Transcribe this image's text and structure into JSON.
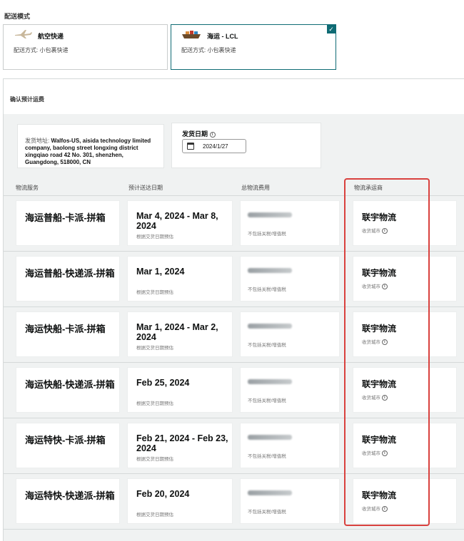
{
  "delivery_mode": {
    "label": "配送模式",
    "options": [
      {
        "title": "航空快递",
        "subtitle": "配送方式: 小包裹快递",
        "selected": false,
        "icon": "airplane-icon"
      },
      {
        "title": "海运 - LCL",
        "subtitle": "配送方式: 小包裹快递",
        "selected": true,
        "icon": "ship-icon"
      }
    ]
  },
  "confirm": {
    "title": "确认预计运费",
    "address_label": "发货地址:",
    "address_value": "Walfos-US, aisida technology limited company, baolong street longxing district xingqiao road 42 No. 301, shenzhen, Guangdong, 518000, CN",
    "ship_date_label": "发货日期",
    "ship_date_value": "2024/1/27"
  },
  "columns": [
    "物流服务",
    "预计送达日期",
    "总物流费用",
    "物流承运商"
  ],
  "rows": [
    {
      "service": "海运普船-卡派-拼箱",
      "date": "Mar 4, 2024 - Mar 8, 2024",
      "date_note": "根据交货日期预估",
      "fee_note": "不包括关税/增值税",
      "carrier": "联宇物流",
      "carrier_note": "收货城市"
    },
    {
      "service": "海运普船-快递派-拼箱",
      "date": "Mar 1, 2024",
      "date_note": "根据交货日期预估",
      "fee_note": "不包括关税/增值税",
      "carrier": "联宇物流",
      "carrier_note": "收货城市"
    },
    {
      "service": "海运快船-卡派-拼箱",
      "date": "Mar 1, 2024 - Mar 2, 2024",
      "date_note": "根据交货日期预估",
      "fee_note": "不包括关税/增值税",
      "carrier": "联宇物流",
      "carrier_note": "收货城市"
    },
    {
      "service": "海运快船-快递派-拼箱",
      "date": "Feb 25, 2024",
      "date_note": "根据交货日期预估",
      "fee_note": "不包括关税/增值税",
      "carrier": "联宇物流",
      "carrier_note": "收货城市"
    },
    {
      "service": "海运特快-卡派-拼箱",
      "date": "Feb 21, 2024 - Feb 23, 2024",
      "date_note": "根据交货日期预估",
      "fee_note": "不包括关税/增值税",
      "carrier": "联宇物流",
      "carrier_note": "收货城市"
    },
    {
      "service": "海运特快-快递派-拼箱",
      "date": "Feb 20, 2024",
      "date_note": "根据交货日期预估",
      "fee_note": "不包括关税/增值税",
      "carrier": "联宇物流",
      "carrier_note": "收货城市"
    }
  ],
  "colors": {
    "accent": "#0f6b74",
    "highlight": "#d9413e",
    "panel": "#f0f2f2"
  }
}
